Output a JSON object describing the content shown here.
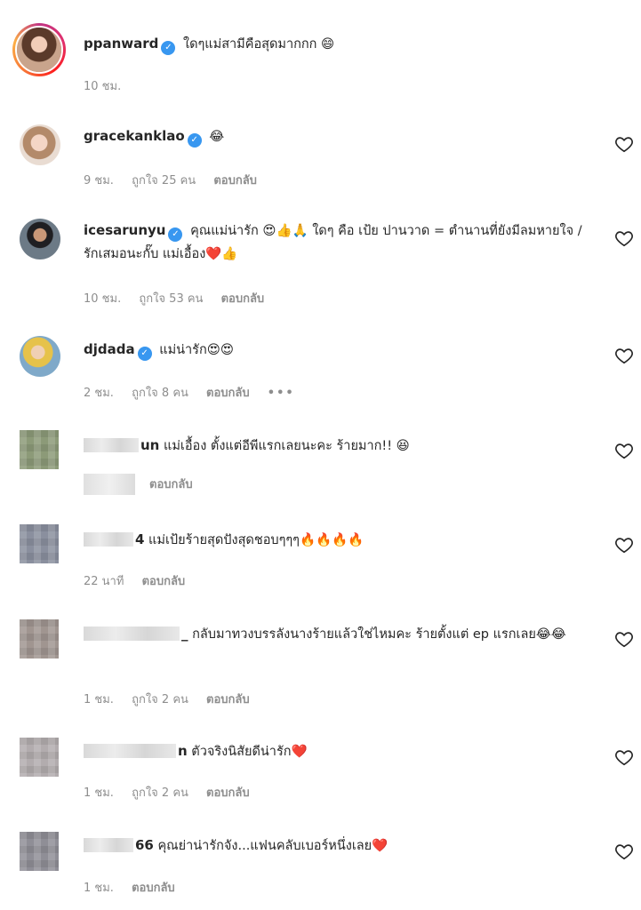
{
  "comments": [
    {
      "username": "ppanward",
      "text": "ใดๆแม่สามีคือสุดมากกก 😄",
      "time": "10 ชม.",
      "likes": "",
      "reply": ""
    },
    {
      "username": "gracekanklao",
      "text": "😂",
      "time": "9 ชม.",
      "likes": "ถูกใจ 25 คน",
      "reply": "ตอบกลับ"
    },
    {
      "username": "icesarunyu",
      "text": "คุณแม่น่ารัก 😍👍🙏 ใดๆ คือ เป้ย ปานวาด = ตำนานที่ยังมีลมหายใจ / รักเสมอนะกั๊บ แม่เอื้อง❤️👍",
      "time": "10 ชม.",
      "likes": "ถูกใจ 53 คน",
      "reply": "ตอบกลับ"
    },
    {
      "username": "djdada",
      "text": "แม่น่ารัก😍😍",
      "time": "2 ชม.",
      "likes": "ถูกใจ 8 คน",
      "reply": "ตอบกลับ",
      "more": "•••"
    },
    {
      "username_suffix": "un",
      "text": "แม่เอื้อง ตั้งแต่อีพีแรกเลยนะคะ ร้ายมาก!! 😆",
      "reply": "ตอบกลับ"
    },
    {
      "username_suffix": "4",
      "text": "แม่เป้ยร้ายสุดปังสุดชอบๆๆๆ🔥🔥🔥🔥",
      "time": "22 นาที",
      "reply": "ตอบกลับ"
    },
    {
      "username_suffix": "_",
      "text": "กลับมาทวงบรรลังนางร้ายแล้วใช่ไหมคะ ร้ายตั้งแต่ ep แรกเลย😂😂",
      "time": "1 ชม.",
      "likes": "ถูกใจ 2 คน",
      "reply": "ตอบกลับ"
    },
    {
      "username_suffix": "n",
      "text": "ตัวจริงนิสัยดีน่ารัก❤️",
      "time": "1 ชม.",
      "likes": "ถูกใจ 2 คน",
      "reply": "ตอบกลับ"
    },
    {
      "username_suffix": "66",
      "text": "คุณย่าน่ารักจัง...แฟนคลับเบอร์หนึ่งเลย❤️",
      "time": "1 ชม.",
      "reply": "ตอบกลับ"
    }
  ],
  "icons": {
    "verified": "verified-badge-icon",
    "like": "heart-outline-icon"
  },
  "colors": {
    "verified": "#3897f0",
    "meta": "#8e8e8e",
    "text": "#262626"
  }
}
